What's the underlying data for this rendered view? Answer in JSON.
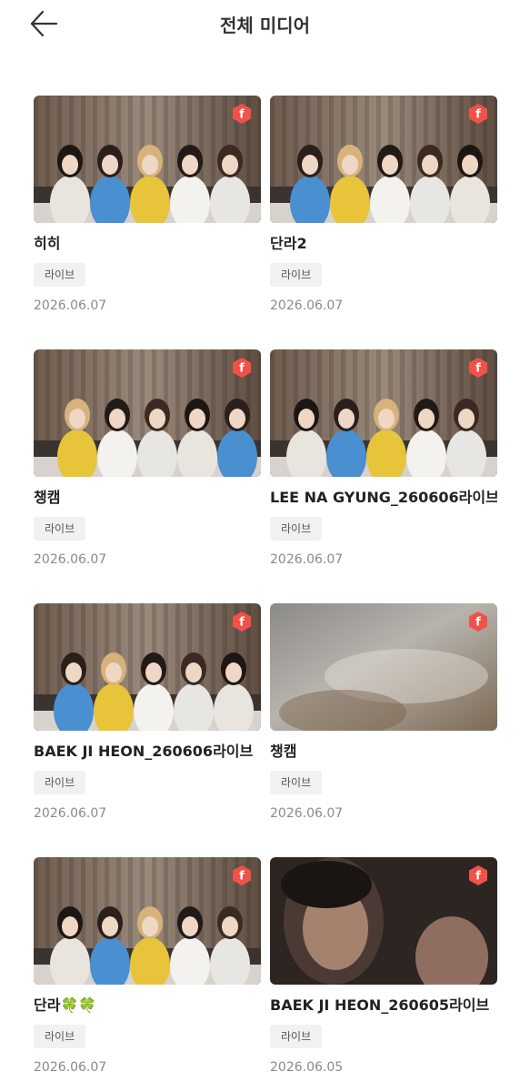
{
  "header": {
    "title": "전체 미디어",
    "back_icon": "arrow-left-icon"
  },
  "colors": {
    "badge": "#f0524a",
    "tag_bg": "#f1f1f3",
    "date": "#8a8a8a"
  },
  "media": [
    {
      "title": "히히",
      "tag": "라이브",
      "date": "2026.06.07",
      "scene": "group"
    },
    {
      "title": "단라2",
      "tag": "라이브",
      "date": "2026.06.07",
      "scene": "group"
    },
    {
      "title": "챙캠",
      "tag": "라이브",
      "date": "2026.06.07",
      "scene": "group"
    },
    {
      "title": "LEE NA GYUNG_260606라이브",
      "tag": "라이브",
      "date": "2026.06.07",
      "scene": "group"
    },
    {
      "title": "BAEK JI HEON_260606라이브",
      "tag": "라이브",
      "date": "2026.06.07",
      "scene": "group"
    },
    {
      "title": "챙캠",
      "tag": "라이브",
      "date": "2026.06.07",
      "scene": "blur"
    },
    {
      "title": "단라🍀🍀",
      "tag": "라이브",
      "date": "2026.06.07",
      "scene": "group"
    },
    {
      "title": "BAEK JI HEON_260605라이브",
      "tag": "라이브",
      "date": "2026.06.05",
      "scene": "dark"
    }
  ]
}
